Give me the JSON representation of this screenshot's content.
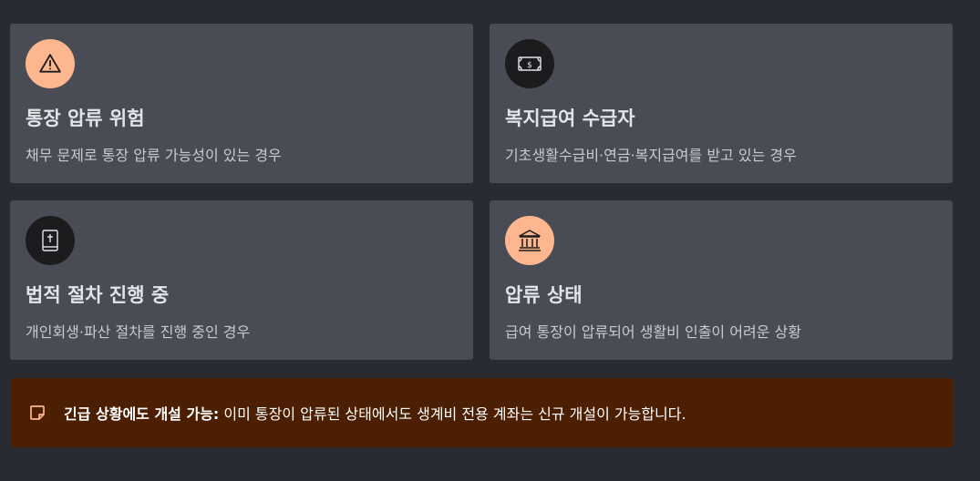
{
  "cards": [
    {
      "icon": "warning-icon",
      "icon_bg": "#fdb68d",
      "title": "통장 압류 위험",
      "description": "채무 문제로 통장 압류 가능성이 있는 경우"
    },
    {
      "icon": "money-bill-icon",
      "icon_bg": "#1c1c1e",
      "title": "복지급여 수급자",
      "description": "기초생활수급비·연금·복지급여를 받고 있는 경우"
    },
    {
      "icon": "bible-icon",
      "icon_bg": "#1c1c1e",
      "title": "법적 절차 진행 중",
      "description": "개인회생·파산 절차를 진행 중인 경우"
    },
    {
      "icon": "bank-icon",
      "icon_bg": "#fdb68d",
      "title": "압류 상태",
      "description": "급여 통장이 압류되어 생활비 인출이 어려운 상황"
    }
  ],
  "notice": {
    "icon": "sticky-note-icon",
    "accent": "#fdb68d",
    "background": "#4c1f02",
    "bold": "긴급 상황에도 개설 가능:",
    "text": " 이미 통장이 압류된 상태에서도 생계비 전용 계좌는 신규 개설이 가능합니다."
  }
}
